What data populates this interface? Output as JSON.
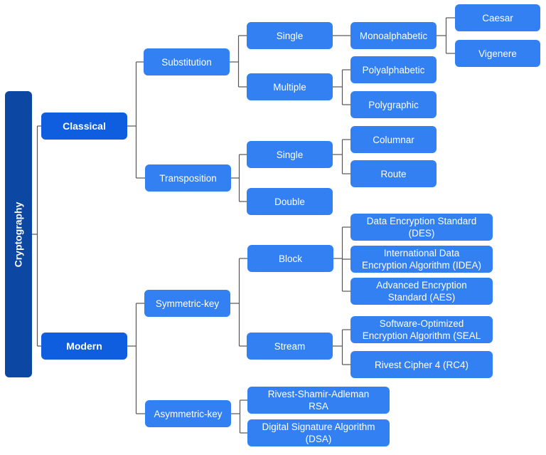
{
  "diagram": {
    "title": "Cryptography",
    "colors": {
      "root": "#0c47a3",
      "level1": "#0f5ee0",
      "node": "#3380f2",
      "text": "#ffffff",
      "connector": "#555555"
    },
    "nodes": [
      {
        "id": "root",
        "label": "Cryptography",
        "parent": null
      },
      {
        "id": "classical",
        "label": "Classical",
        "parent": "root"
      },
      {
        "id": "modern",
        "label": "Modern",
        "parent": "root"
      },
      {
        "id": "substitution",
        "label": "Substitution",
        "parent": "classical"
      },
      {
        "id": "transposition",
        "label": "Transposition",
        "parent": "classical"
      },
      {
        "id": "sub-single",
        "label": "Single",
        "parent": "substitution"
      },
      {
        "id": "sub-multiple",
        "label": "Multiple",
        "parent": "substitution"
      },
      {
        "id": "monoalphabetic",
        "label": "Monoalphabetic",
        "parent": "sub-single"
      },
      {
        "id": "caesar",
        "label": "Caesar",
        "parent": "monoalphabetic"
      },
      {
        "id": "vigenere",
        "label": "Vigenere",
        "parent": "monoalphabetic"
      },
      {
        "id": "polyalphabetic",
        "label": "Polyalphabetic",
        "parent": "sub-multiple"
      },
      {
        "id": "polygraphic",
        "label": "Polygraphic",
        "parent": "sub-multiple"
      },
      {
        "id": "trans-single",
        "label": "Single",
        "parent": "transposition"
      },
      {
        "id": "trans-double",
        "label": "Double",
        "parent": "transposition"
      },
      {
        "id": "columnar",
        "label": "Columnar",
        "parent": "trans-single"
      },
      {
        "id": "route",
        "label": "Route",
        "parent": "trans-single"
      },
      {
        "id": "symmetric",
        "label": "Symmetric-key",
        "parent": "modern"
      },
      {
        "id": "asymmetric",
        "label": "Asymmetric-key",
        "parent": "modern"
      },
      {
        "id": "block",
        "label": "Block",
        "parent": "symmetric"
      },
      {
        "id": "stream",
        "label": "Stream",
        "parent": "symmetric"
      },
      {
        "id": "des",
        "label": "Data Encryption Standard\n(DES)",
        "parent": "block"
      },
      {
        "id": "idea",
        "label": "International Data\nEncryption Algorithm (IDEA)",
        "parent": "block"
      },
      {
        "id": "aes",
        "label": "Advanced Encryption\nStandard (AES)",
        "parent": "block"
      },
      {
        "id": "seal",
        "label": "Software-Optimized\nEncryption Algorithm (SEAL",
        "parent": "stream"
      },
      {
        "id": "rc4",
        "label": "Rivest Cipher 4 (RC4)",
        "parent": "stream"
      },
      {
        "id": "rsa",
        "label": "Rivest-Shamir-Adleman\nRSA",
        "parent": "asymmetric"
      },
      {
        "id": "dsa",
        "label": "Digital Signature Algorithm\n(DSA)",
        "parent": "asymmetric"
      }
    ]
  }
}
